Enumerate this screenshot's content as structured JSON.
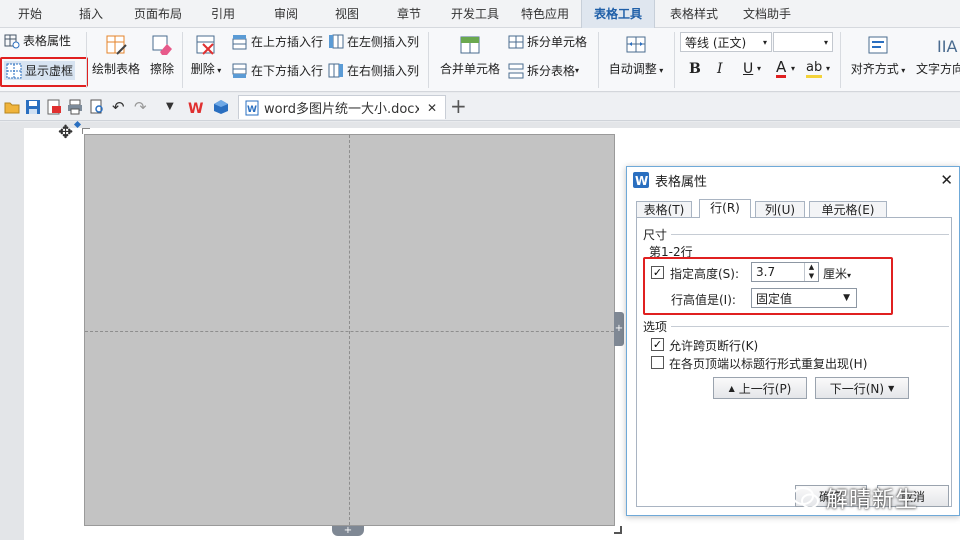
{
  "menu_tabs": [
    {
      "label": "开始"
    },
    {
      "label": "插入"
    },
    {
      "label": "页面布局"
    },
    {
      "label": "引用"
    },
    {
      "label": "审阅"
    },
    {
      "label": "视图"
    },
    {
      "label": "章节"
    },
    {
      "label": "开发工具"
    },
    {
      "label": "特色应用"
    },
    {
      "label": "表格工具"
    },
    {
      "label": "表格样式"
    },
    {
      "label": "文档助手"
    }
  ],
  "ribbon": {
    "table_properties": "表格属性",
    "show_gridlines": "显示虚框",
    "draw_table": "绘制表格",
    "erase": "擦除",
    "delete": "删除",
    "insert_above": "在上方插入行",
    "insert_below": "在下方插入行",
    "insert_left": "在左侧插入列",
    "insert_right": "在右侧插入列",
    "merge_cells": "合并单元格",
    "split_cells": "拆分单元格",
    "split_table": "拆分表格",
    "autofit": "自动调整",
    "font_name": "等线 (正文)",
    "font_size": "",
    "bold": "B",
    "italic": "I",
    "underline": "U",
    "font_color": "A",
    "highlight": "ab",
    "align": "对齐方式",
    "text_direction": "文字方向"
  },
  "doc_tab": {
    "title": "word多图片统一大小.docx *"
  },
  "dialog": {
    "title": "表格属性",
    "tabs": [
      {
        "label": "表格(T)"
      },
      {
        "label": "行(R)"
      },
      {
        "label": "列(U)"
      },
      {
        "label": "单元格(E)"
      }
    ],
    "size_section": "尺寸",
    "row_range": "第1-2行",
    "specify_height_label": "指定高度(S):",
    "specify_height_checked": true,
    "height_value": "3.7",
    "height_unit": "厘米",
    "row_height_mode_label": "行高值是(I):",
    "row_height_mode_value": "固定值",
    "options_section": "选项",
    "allow_break_label": "允许跨页断行(K)",
    "allow_break_checked": true,
    "repeat_header_label": "在各页顶端以标题行形式重复出现(H)",
    "repeat_header_checked": false,
    "prev_row": "上一行(P)",
    "next_row": "下一行(N)",
    "ok": "确定",
    "cancel": "取消"
  },
  "watermark": "解晴新生",
  "colors": {
    "accent": "#1f5fa8",
    "highlight": "#e02020",
    "table_fill": "#c3c3c3"
  }
}
